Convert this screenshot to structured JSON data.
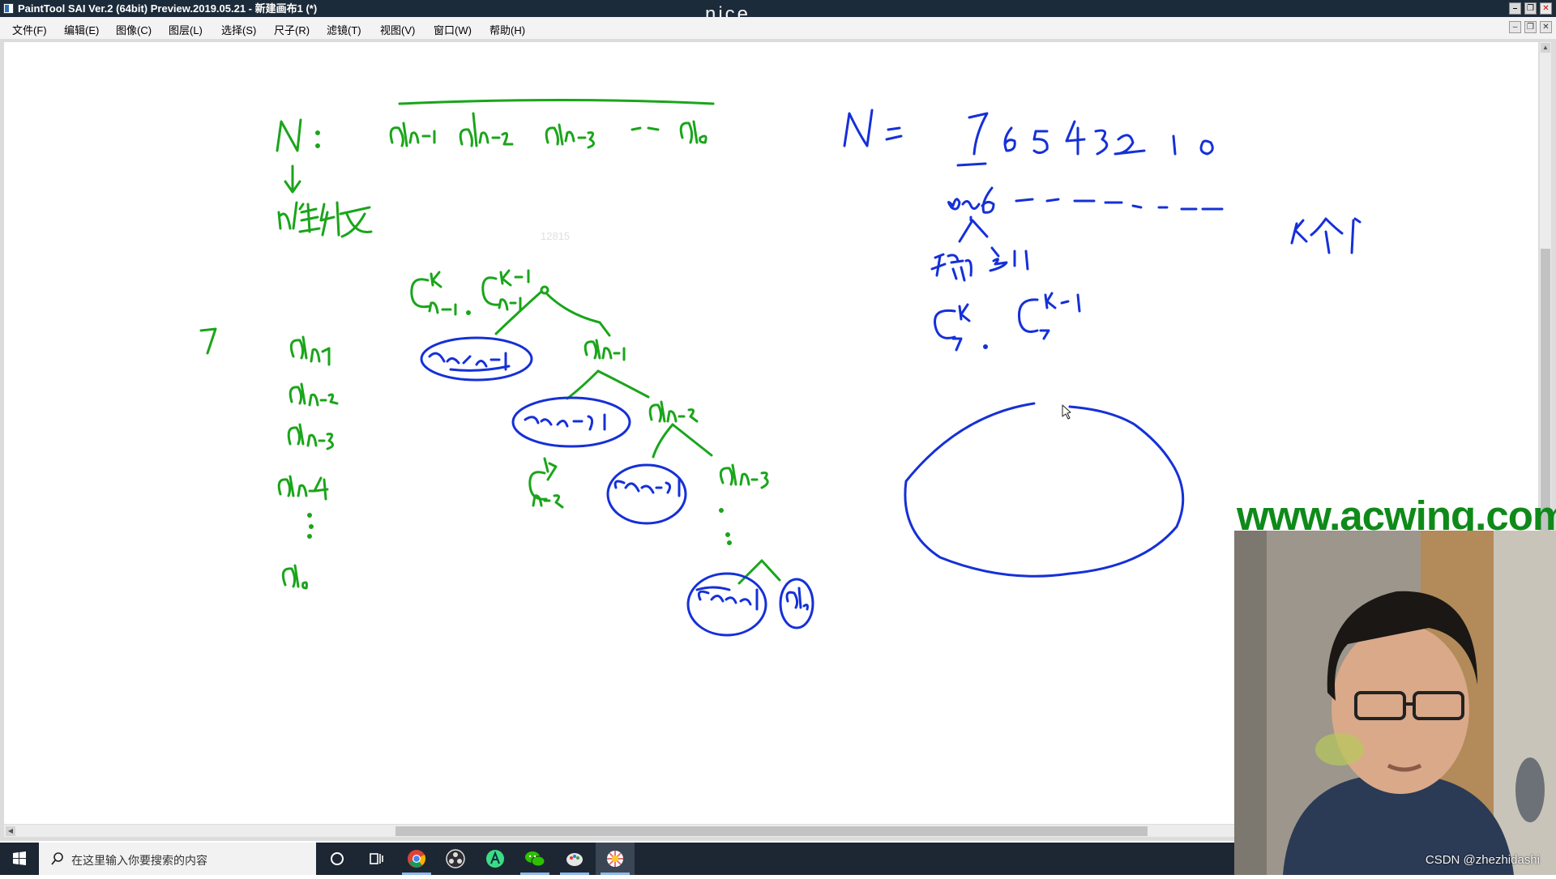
{
  "window": {
    "title": "PaintTool SAI Ver.2 (64bit) Preview.2019.05.21 - 新建画布1 (*)",
    "overlay_text": "nice"
  },
  "menu": {
    "items": [
      "文件(F)",
      "编辑(E)",
      "图像(C)",
      "图层(L)",
      "选择(S)",
      "尺子(R)",
      "滤镜(T)",
      "视图(V)",
      "窗口(W)",
      "帮助(H)"
    ]
  },
  "canvas": {
    "faint_label": "12815",
    "notes": {
      "left_header": "N: a_{n-1} a_{n-2} a_{n-3} … a_0",
      "left_sub": "n位数",
      "right_header": "N: 76543210",
      "right_sub": "0~6 — — — — — —",
      "right_choice": "k个1"
    }
  },
  "watermark": {
    "site": "www.acwing.com",
    "credit": "CSDN @zhezhidashi"
  },
  "taskbar": {
    "search_placeholder": "在这里输入你要搜索的内容",
    "apps": [
      "cortana-icon",
      "task-view-icon",
      "chrome-icon",
      "obs-icon",
      "android-studio-icon",
      "wechat-icon",
      "paint-icon",
      "painttool-sai-icon"
    ]
  },
  "colors": {
    "ink_green": "#1aa51a",
    "ink_blue": "#1530d8",
    "watermark": "#0f8a19",
    "titlebar": "#1c2b3a",
    "taskbar": "#1d2733"
  }
}
